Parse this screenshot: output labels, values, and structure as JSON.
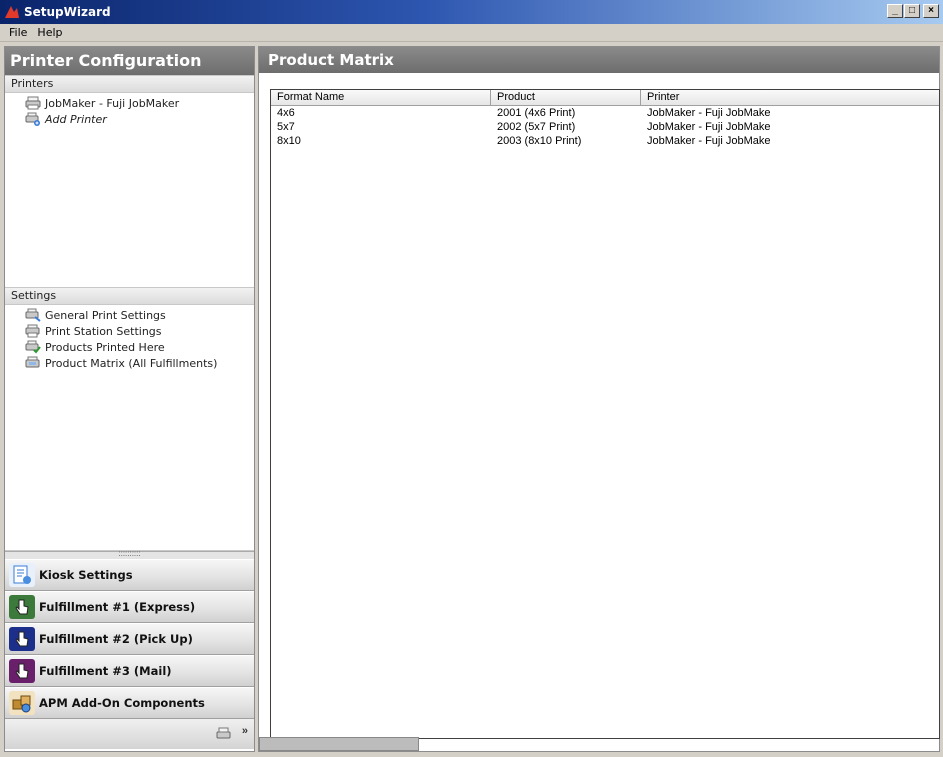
{
  "window": {
    "title": "SetupWizard",
    "controls": {
      "minimize": "_",
      "maximize": "□",
      "close": "×"
    }
  },
  "menu": [
    "File",
    "Help"
  ],
  "left_panel": {
    "title": "Printer Configuration",
    "printers_section": {
      "header": "Printers",
      "items": [
        {
          "label": "JobMaker - Fuji JobMaker",
          "icon": "printer-icon"
        },
        {
          "label": "Add Printer",
          "icon": "add-printer-icon"
        }
      ]
    },
    "settings_section": {
      "header": "Settings",
      "items": [
        {
          "label": "General Print Settings",
          "icon": "print-settings-icon"
        },
        {
          "label": "Print Station Settings",
          "icon": "print-station-icon"
        },
        {
          "label": "Products Printed Here",
          "icon": "products-icon"
        },
        {
          "label": "Product Matrix (All Fulfillments)",
          "icon": "matrix-icon"
        }
      ]
    },
    "splitter": "::::::::::",
    "nav_buttons": [
      {
        "label": "Kiosk Settings",
        "icon": "kiosk-settings-icon",
        "color": "#3a7bd5"
      },
      {
        "label": "Fulfillment #1 (Express)",
        "icon": "hand-pointer-icon",
        "color": "#3c7a3c"
      },
      {
        "label": "Fulfillment #2 (Pick Up)",
        "icon": "hand-pointer-icon",
        "color": "#1c2f8a"
      },
      {
        "label": "Fulfillment #3 (Mail)",
        "icon": "hand-pointer-icon",
        "color": "#6a1f6a"
      },
      {
        "label": "APM Add-On Components",
        "icon": "components-icon",
        "color": "#c08a30"
      }
    ],
    "footer_chevron": "»"
  },
  "right_panel": {
    "title": "Product Matrix",
    "grid": {
      "columns": [
        "Format Name",
        "Product",
        "Printer"
      ],
      "rows": [
        [
          "4x6",
          "2001 (4x6 Print)",
          "JobMaker - Fuji JobMake"
        ],
        [
          "5x7",
          "2002 (5x7 Print)",
          "JobMaker - Fuji JobMake"
        ],
        [
          "8x10",
          "2003 (8x10 Print)",
          "JobMaker - Fuji JobMake"
        ]
      ]
    }
  }
}
